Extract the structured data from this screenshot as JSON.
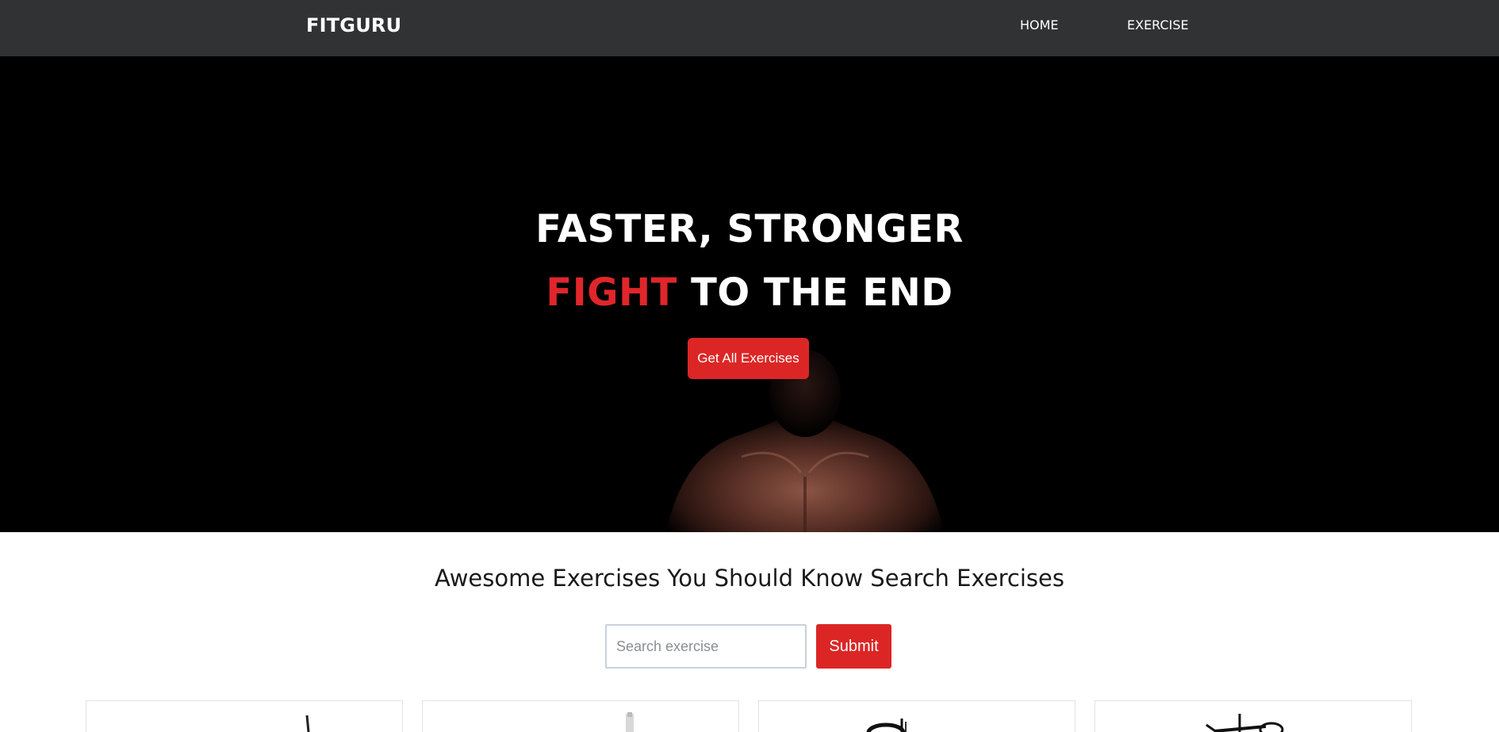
{
  "navbar": {
    "brand": "FITGURU",
    "links": [
      {
        "label": "HOME"
      },
      {
        "label": "EXERCISE"
      }
    ]
  },
  "hero": {
    "line1": "FASTER, STRONGER",
    "line2_accent": "FIGHT",
    "line2_rest": " TO THE END",
    "button_label": "Get All Exercises"
  },
  "exercises": {
    "heading": "Awesome Exercises You Should Know Search Exercises",
    "search_placeholder": "Search exercise",
    "search_value": "",
    "submit_label": "Submit"
  },
  "colors": {
    "navbar_bg": "#313234",
    "accent": "#dc2626",
    "hero_bg": "#000000"
  },
  "icons": {
    "hero_image": "muscular-athlete-image",
    "card_images": [
      "exercise-gif-1",
      "exercise-gif-2",
      "exercise-gif-3",
      "exercise-gif-4"
    ]
  }
}
